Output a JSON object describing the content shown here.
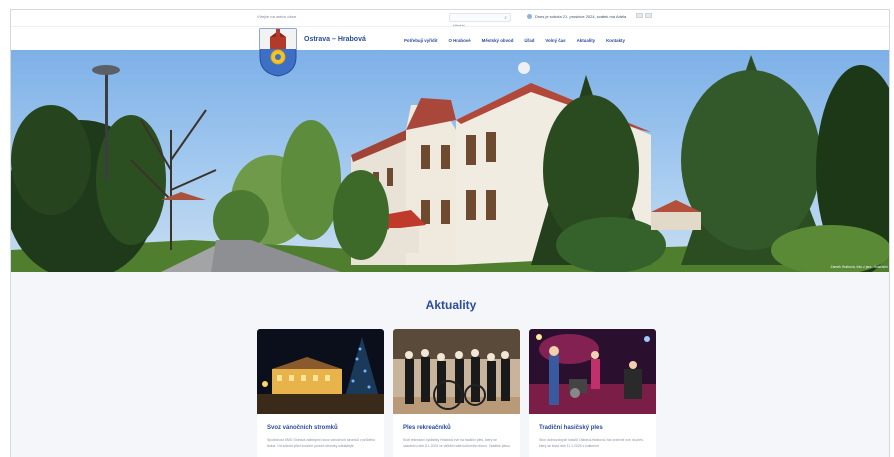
{
  "topbar": {
    "welcome": "Vítejte na webu obce",
    "search_placeholder": "Hledat...",
    "info_text": "Dnes je sobota 21. prosince 2024, svátek má Adéla",
    "lang": "CZ EN"
  },
  "header": {
    "site_name": "Ostrava – Hrabová",
    "nav": [
      "Potřebuji vyřídit",
      "O Hrabové",
      "Městský obvod",
      "Úřad",
      "Volný čas",
      "Aktuality",
      "Kontakty"
    ]
  },
  "hero": {
    "caption": "Zámek Hrabová, foto z jara - ilustrační"
  },
  "news": {
    "heading": "Aktuality",
    "cards": [
      {
        "title": "Svoz vánočních stromků",
        "text": "Společnost SMO Ostrava zabezpečí svoz vánočních stromků v průběhu ledna. Od sobota před svozem prosím stromky odkládejte"
      },
      {
        "title": "Ples rekreačníků",
        "text": "Klub rekreační cyklistiky Hrabová zve na tradiční ples, který se uskuteční dne 8.1.2024 ve velkém sále kulturního domu. Začátek plesu"
      },
      {
        "title": "Tradiční hasičský ples",
        "text": "Sbor dobrovolných hasičů Ostrava-Hrabová Vás srdečně zve na ples, který se koná dne 11.1.2025 v kulturním"
      }
    ]
  },
  "colors": {
    "brand": "#2a4c9c",
    "news_bg": "#f5f6f9"
  }
}
